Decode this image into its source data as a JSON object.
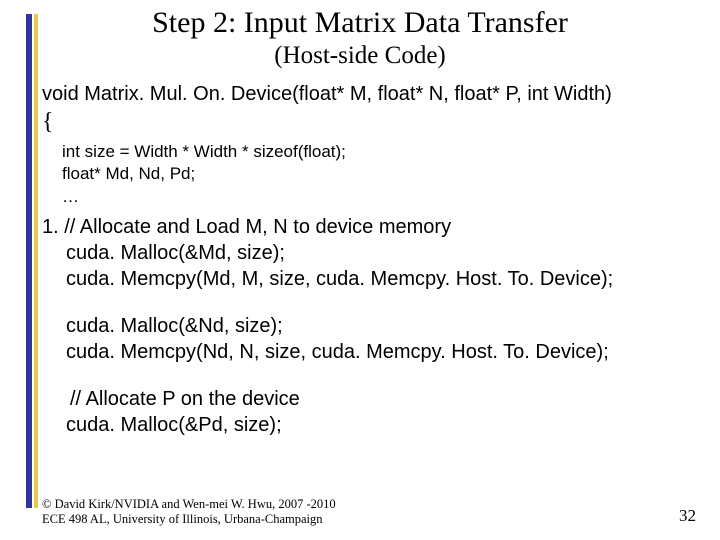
{
  "title": "Step 2: Input Matrix Data Transfer",
  "subtitle": "(Host-side Code)",
  "code": {
    "signature": "void Matrix. Mul. On. Device(float* M, float* N, float* P, int Width)",
    "open_brace": "{",
    "locals": {
      "l1": "int size = Width * Width * sizeof(float);",
      "l2": "float* Md, Nd, Pd;",
      "l3": "…"
    },
    "b1": "1. // Allocate and Load M, N to device memory",
    "b2": "cuda. Malloc(&Md, size);",
    "b3": "cuda. Memcpy(Md, M, size, cuda. Memcpy. Host. To. Device);",
    "b4": "cuda. Malloc(&Nd, size);",
    "b5": "cuda. Memcpy(Nd, N, size, cuda. Memcpy. Host. To. Device);",
    "b6": "// Allocate P on the device",
    "b7": "cuda. Malloc(&Pd, size);"
  },
  "footer": {
    "line1": "© David Kirk/NVIDIA and Wen-mei W. Hwu, 2007 -2010",
    "line2": "ECE 498 AL, University of Illinois, Urbana-Champaign"
  },
  "page_number": "32"
}
